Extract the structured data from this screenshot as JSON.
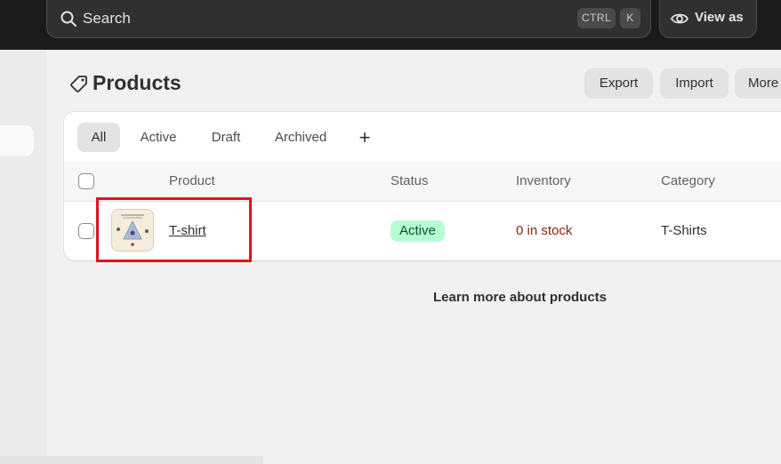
{
  "topbar": {
    "search_label": "Search",
    "shortcut_ctrl": "CTRL",
    "shortcut_k": "K",
    "view_as_label": "View as"
  },
  "page": {
    "title": "Products",
    "actions": {
      "export": "Export",
      "import": "Import",
      "more": "More"
    }
  },
  "tabs": {
    "all": "All",
    "active": "Active",
    "draft": "Draft",
    "archived": "Archived",
    "add": "+"
  },
  "table": {
    "headers": {
      "product": "Product",
      "status": "Status",
      "inventory": "Inventory",
      "category": "Category"
    },
    "rows": [
      {
        "product": "T-shirt",
        "status": "Active",
        "inventory": "0 in stock",
        "category": "T-Shirts"
      }
    ]
  },
  "footer": {
    "learn_more": "Learn more about products"
  },
  "colors": {
    "topbar": "#1a1a1a",
    "status_active_bg": "#b4fed2",
    "inventory_out": "#8e1f0b",
    "highlight": "#e0121f"
  }
}
